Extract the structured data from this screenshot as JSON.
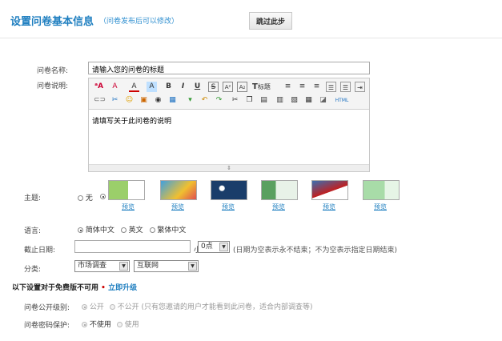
{
  "header": {
    "title": "设置问卷基本信息",
    "subtitle": "（问卷发布后可以修改）",
    "skip_label": "跳过此步"
  },
  "form": {
    "name_label": "问卷名称:",
    "name_value": "请输入您的问卷的标题",
    "desc_label": "问卷说明:",
    "desc_value": "请填写关于此问卷的说明",
    "toolbar_title_label": "标题",
    "toolbar_html_label": "HTML",
    "theme_label": "主题:",
    "theme_none": "无",
    "theme_preview": "预览",
    "lang_label": "语言:",
    "lang_options": [
      "简体中文",
      "英文",
      "繁体中文"
    ],
    "deadline_label": "截止日期:",
    "hour_label": "小时:",
    "hour_value": "0点",
    "deadline_hint": "(日期为空表示永不结束；不为空表示指定日期结束)",
    "category_label": "分类:",
    "category_1": "市场调查",
    "category_2": "互联网"
  },
  "paid_section": {
    "title": "以下设置对于免费版不可用",
    "upgrade_label": "立即升级",
    "visibility_label": "问卷公开级别:",
    "visibility_public": "公开",
    "visibility_private": "不公开",
    "visibility_hint": "(只有您邀请的用户才能看到此问卷，适合内部调查等)",
    "password_label": "问卷密码保护:",
    "password_off": "不使用",
    "password_on": "使用"
  },
  "colors": {
    "accent": "#1f7fc0"
  }
}
